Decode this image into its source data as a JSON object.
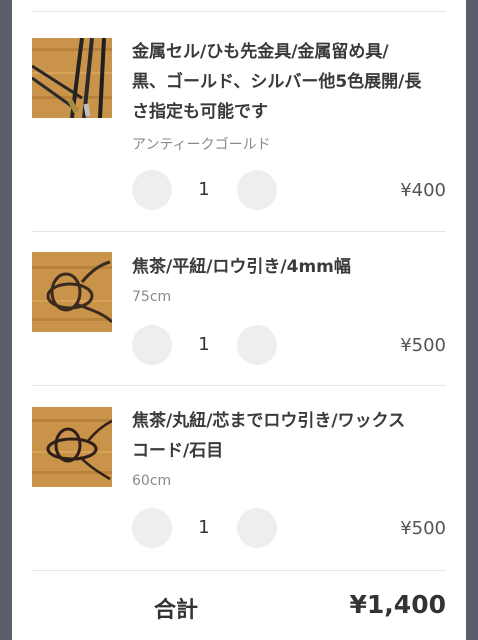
{
  "cart": {
    "items": [
      {
        "title": "金属セル/ひも先金具/金属留め具/黒、ゴールド、シルバー他5色展開/長さ指定も可能です",
        "variant": "アンティークゴールド",
        "quantity": "1",
        "price": "¥400",
        "thumb_icon": "metal-shoelace-tips-photo"
      },
      {
        "title": "焦茶/平紐/ロウ引き/4mm幅",
        "variant": "75cm",
        "quantity": "1",
        "price": "¥500",
        "thumb_icon": "brown-flat-waxed-lace-photo"
      },
      {
        "title": "焦茶/丸紐/芯までロウ引き/ワックスコード/石目",
        "variant": "60cm",
        "quantity": "1",
        "price": "¥500",
        "thumb_icon": "brown-round-waxed-cord-photo"
      }
    ],
    "total_label": "合計",
    "total_value": "¥1,400"
  },
  "colors": {
    "backdrop": "#5b5e6b",
    "sheet": "#ffffff",
    "button": "#eeeeee",
    "wood": "#c9944a"
  }
}
